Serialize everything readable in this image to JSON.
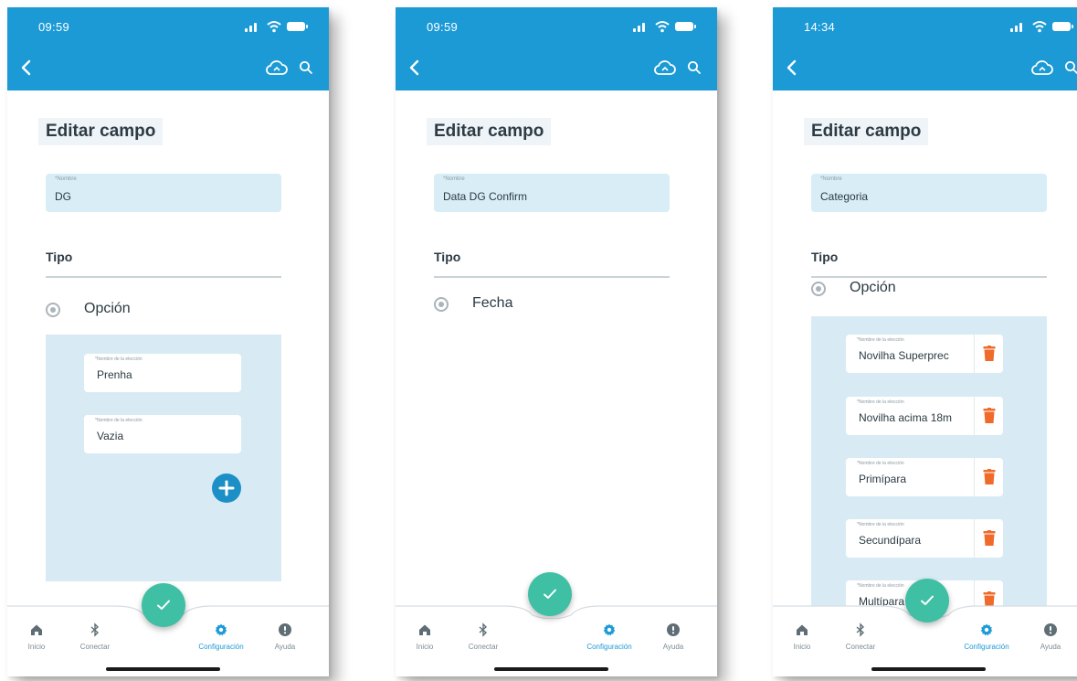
{
  "colors": {
    "header_blue": "#1c9ad6",
    "field_bg": "#d9edf7",
    "panel_bg": "#d8ebf5",
    "fab_green": "#3fbfa4",
    "delete_orange": "#f06a2a",
    "active_nav": "#1c9ad6"
  },
  "labels": {
    "page_title": "Editar campo",
    "name_label": "*Nombre",
    "type_heading": "Tipo",
    "choice_label": "*Nombre de la elección"
  },
  "nav": {
    "items": [
      {
        "label": "Inicio",
        "icon": "home-icon"
      },
      {
        "label": "Conectar",
        "icon": "bluetooth-icon"
      },
      {
        "label": "Configuración",
        "icon": "gear-icon"
      },
      {
        "label": "Ayuda",
        "icon": "help-icon"
      }
    ],
    "active": "Configuración"
  },
  "screens": [
    {
      "time": "09:59",
      "name_value": "DG",
      "type_option": "Opción",
      "choices": [
        "Prenha",
        "Vazia"
      ],
      "has_add_button": true
    },
    {
      "time": "09:59",
      "name_value": "Data DG Confirm",
      "type_option": "Fecha",
      "choices": [],
      "has_add_button": false
    },
    {
      "time": "14:34",
      "name_value": "Categoria",
      "type_option": "Opción",
      "choices": [
        "Novilha Superprec",
        "Novilha acima 18m",
        "Primípara",
        "Secundípara",
        "Multípara"
      ],
      "has_add_button": false
    }
  ]
}
